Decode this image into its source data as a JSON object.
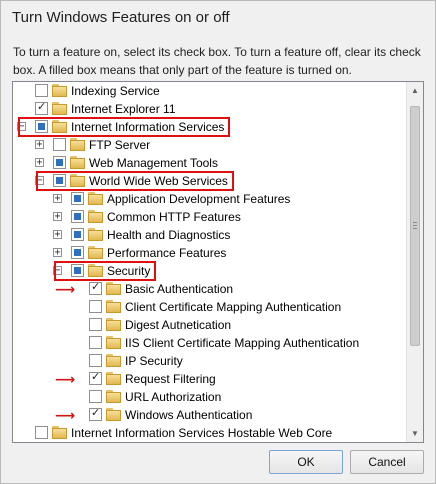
{
  "window": {
    "title": "Turn Windows Features on or off",
    "instructions": "To turn a feature on, select its check box. To turn a feature off, clear its check box. A filled box means that only part of the feature is turned on."
  },
  "tree": [
    {
      "label": "Indexing Service",
      "state": "unchecked",
      "expander": "",
      "highlight": false,
      "arrow": false
    },
    {
      "label": "Internet Explorer 11",
      "state": "checked",
      "expander": "",
      "highlight": false,
      "arrow": false
    },
    {
      "label": "Internet Information Services",
      "state": "partial",
      "expander": "−",
      "highlight": true,
      "arrow": false
    },
    {
      "label": "FTP Server",
      "state": "unchecked",
      "expander": "+",
      "highlight": false,
      "arrow": false
    },
    {
      "label": "Web Management Tools",
      "state": "partial",
      "expander": "+",
      "highlight": false,
      "arrow": false
    },
    {
      "label": "World Wide Web Services",
      "state": "partial",
      "expander": "−",
      "highlight": true,
      "arrow": false
    },
    {
      "label": "Application Development Features",
      "state": "partial",
      "expander": "+",
      "highlight": false,
      "arrow": false
    },
    {
      "label": "Common HTTP Features",
      "state": "partial",
      "expander": "+",
      "highlight": false,
      "arrow": false
    },
    {
      "label": "Health and Diagnostics",
      "state": "partial",
      "expander": "+",
      "highlight": false,
      "arrow": false
    },
    {
      "label": "Performance Features",
      "state": "partial",
      "expander": "+",
      "highlight": false,
      "arrow": false
    },
    {
      "label": "Security",
      "state": "partial",
      "expander": "−",
      "highlight": true,
      "arrow": false
    },
    {
      "label": "Basic Authentication",
      "state": "checked",
      "expander": "",
      "highlight": false,
      "arrow": true
    },
    {
      "label": "Client Certificate Mapping Authentication",
      "state": "unchecked",
      "expander": "",
      "highlight": false,
      "arrow": false
    },
    {
      "label": "Digest Autnetication",
      "state": "unchecked",
      "expander": "",
      "highlight": false,
      "arrow": false
    },
    {
      "label": "IIS Client Certificate Mapping Authentication",
      "state": "unchecked",
      "expander": "",
      "highlight": false,
      "arrow": false
    },
    {
      "label": "IP Security",
      "state": "unchecked",
      "expander": "",
      "highlight": false,
      "arrow": false
    },
    {
      "label": "Request Filtering",
      "state": "checked",
      "expander": "",
      "highlight": false,
      "arrow": true
    },
    {
      "label": "URL Authorization",
      "state": "unchecked",
      "expander": "",
      "highlight": false,
      "arrow": false
    },
    {
      "label": "Windows Authentication",
      "state": "checked",
      "expander": "",
      "highlight": false,
      "arrow": true
    },
    {
      "label": "Internet Information Services Hostable Web Core",
      "state": "unchecked",
      "expander": "",
      "highlight": false,
      "arrow": false
    }
  ],
  "buttons": {
    "ok": "OK",
    "cancel": "Cancel"
  },
  "colors": {
    "highlight": "#e01010",
    "partial_fill": "#2f6fbf"
  }
}
